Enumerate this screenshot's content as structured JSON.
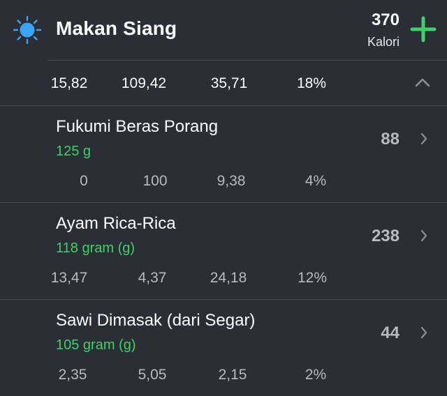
{
  "meal": {
    "title": "Makan Siang",
    "calories": "370",
    "calories_unit": "Kalori",
    "icon": "sun-icon",
    "summary": [
      "15,82",
      "109,42",
      "35,71",
      "18%"
    ]
  },
  "items": [
    {
      "name": "Fukumi Beras Porang",
      "portion": "125 g",
      "calories": "88",
      "values": [
        "0",
        "100",
        "9,38",
        "4%"
      ]
    },
    {
      "name": "Ayam Rica-Rica",
      "portion": "118 gram (g)",
      "calories": "238",
      "values": [
        "13,47",
        "4,37",
        "24,18",
        "12%"
      ]
    },
    {
      "name": "Sawi Dimasak (dari Segar)",
      "portion": "105 gram (g)",
      "calories": "44",
      "values": [
        "2,35",
        "5,05",
        "2,15",
        "2%"
      ]
    }
  ],
  "colors": {
    "background": "#2c2e35",
    "accent_green": "#3fd06a",
    "sun_blue": "#3aa3f5",
    "muted_text": "#b8bac0"
  }
}
